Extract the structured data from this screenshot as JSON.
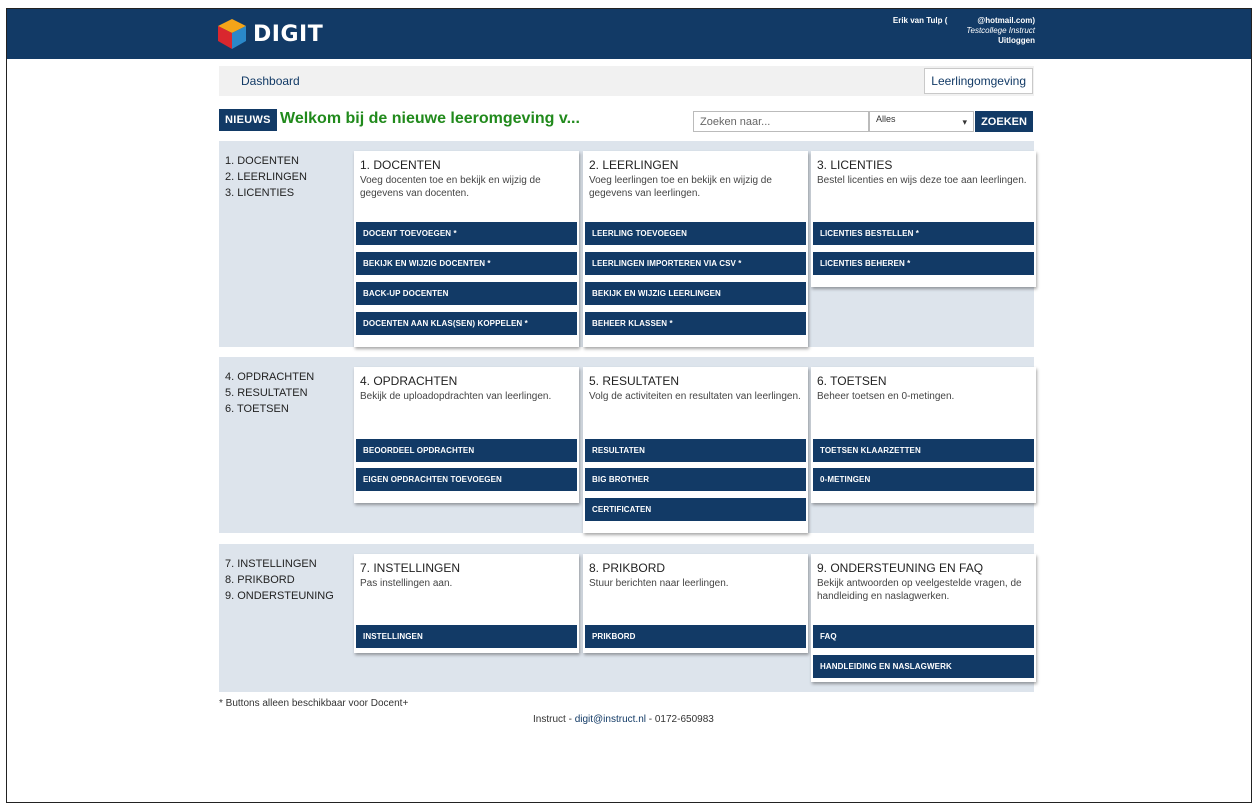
{
  "header": {
    "logo_text": "DIGIT",
    "user_name": "Erik van Tulp (",
    "user_email": "@hotmail.com)",
    "organization": "Testcollege Instruct",
    "logout_label": "Uitloggen"
  },
  "breadcrumb": {
    "current": "Dashboard",
    "environment_button": "Leerlingomgeving"
  },
  "news": {
    "badge": "NIEUWS",
    "headline": "Welkom bij de nieuwe leeromgeving v..."
  },
  "search": {
    "placeholder": "Zoeken naar...",
    "scope_selected": "Alles",
    "button_label": "ZOEKEN"
  },
  "sections": [
    {
      "index": [
        "1. DOCENTEN",
        "2. LEERLINGEN",
        "3. LICENTIES"
      ],
      "cards": [
        {
          "title": "1. DOCENTEN",
          "description": "Voeg docenten toe en bekijk en wijzig de gegevens van docenten.",
          "buttons": [
            "DOCENT TOEVOEGEN *",
            "BEKIJK EN WIJZIG DOCENTEN *",
            "BACK-UP DOCENTEN",
            "DOCENTEN AAN KLAS(SEN) KOPPELEN *"
          ]
        },
        {
          "title": "2. LEERLINGEN",
          "description": "Voeg leerlingen toe en bekijk en wijzig de gegevens van leerlingen.",
          "buttons": [
            "LEERLING TOEVOEGEN",
            "LEERLINGEN IMPORTEREN VIA CSV *",
            "BEKIJK EN WIJZIG LEERLINGEN",
            "BEHEER KLASSEN *"
          ]
        },
        {
          "title": "3. LICENTIES",
          "description": "Bestel licenties en wijs deze toe aan leerlingen.",
          "buttons": [
            "LICENTIES BESTELLEN *",
            "LICENTIES BEHEREN *"
          ]
        }
      ]
    },
    {
      "index": [
        "4. OPDRACHTEN",
        "5. RESULTATEN",
        "6. TOETSEN"
      ],
      "cards": [
        {
          "title": "4. OPDRACHTEN",
          "description": "Bekijk de uploadopdrachten van leerlingen.",
          "buttons": [
            "BEOORDEEL OPDRACHTEN",
            "EIGEN OPDRACHTEN TOEVOEGEN"
          ]
        },
        {
          "title": "5. RESULTATEN",
          "description": "Volg de activiteiten en resultaten van leerlingen.",
          "buttons": [
            "RESULTATEN",
            "BIG BROTHER",
            "CERTIFICATEN"
          ]
        },
        {
          "title": "6. TOETSEN",
          "description": "Beheer toetsen en 0-metingen.",
          "buttons": [
            "TOETSEN KLAARZETTEN",
            "0-METINGEN"
          ]
        }
      ]
    },
    {
      "index": [
        "7. INSTELLINGEN",
        "8. PRIKBORD",
        "9. ONDERSTEUNING"
      ],
      "cards": [
        {
          "title": "7. INSTELLINGEN",
          "description": "Pas instellingen aan.",
          "buttons": [
            "INSTELLINGEN"
          ]
        },
        {
          "title": "8. PRIKBORD",
          "description": "Stuur berichten naar leerlingen.",
          "buttons": [
            "PRIKBORD"
          ]
        },
        {
          "title": "9. ONDERSTEUNING EN FAQ",
          "description": "Bekijk antwoorden op veelgestelde vragen, de handleiding en naslagwerken.",
          "buttons": [
            "FAQ",
            "HANDLEIDING EN NASLAGWERK"
          ]
        }
      ]
    }
  ],
  "footer": {
    "note": "* Buttons alleen beschikbaar voor Docent+",
    "company": "Instruct - ",
    "email": "digit@instruct.nl",
    "phone": " - 0172-650983"
  },
  "colors": {
    "primary": "#123a66",
    "section_bg": "#dde4ec",
    "news_green": "#218a1c"
  }
}
